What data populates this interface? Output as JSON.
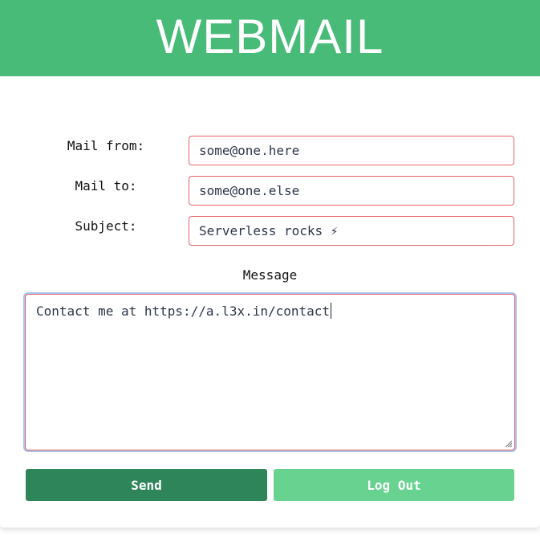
{
  "header": {
    "title": "WEBMAIL"
  },
  "form": {
    "mail_from": {
      "label": "Mail from:",
      "value": "some@one.here"
    },
    "mail_to": {
      "label": "Mail to:",
      "value": "some@one.else"
    },
    "subject": {
      "label": "Subject:",
      "value": "Serverless rocks ⚡"
    },
    "message": {
      "label": "Message",
      "value": "Contact me at https://a.l3x.in/contact"
    }
  },
  "buttons": {
    "send_label": "Send",
    "logout_label": "Log Out"
  },
  "colors": {
    "header_bg": "#48bb78",
    "send_bg": "#2f855a",
    "logout_bg": "#68d391",
    "field_border": "#e5646a"
  }
}
